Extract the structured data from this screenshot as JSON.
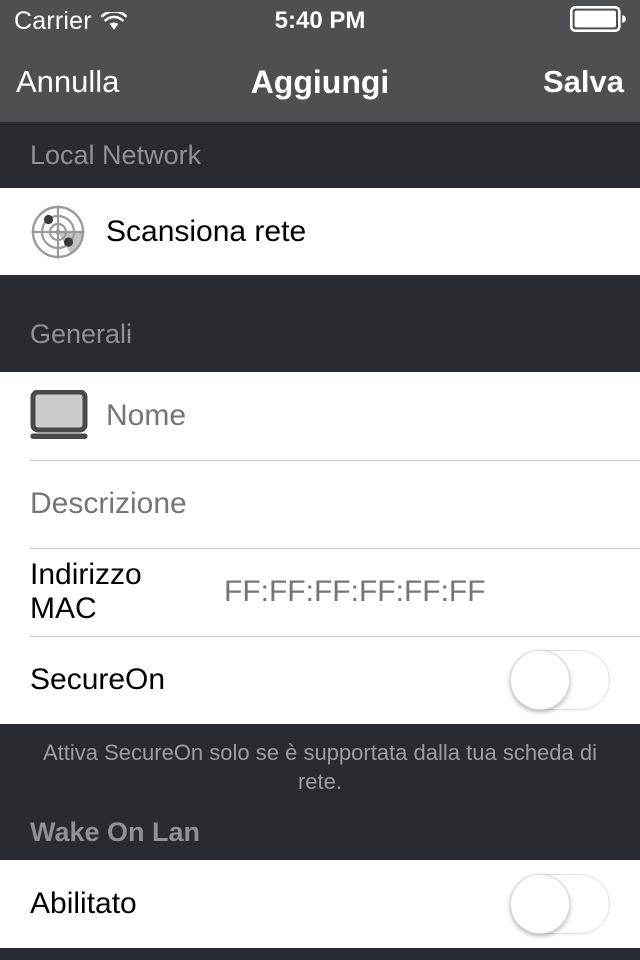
{
  "status_bar": {
    "carrier": "Carrier",
    "wifi_icon": "wifi-icon",
    "time": "5:40 PM",
    "battery_icon": "battery-full-icon"
  },
  "nav_bar": {
    "cancel_label": "Annulla",
    "title": "Aggiungi",
    "save_label": "Salva"
  },
  "sections": {
    "local_network": {
      "header": "Local Network",
      "scan_row": {
        "icon": "radar-icon",
        "label": "Scansiona rete"
      }
    },
    "general": {
      "header": "Generali",
      "name_row": {
        "icon": "laptop-icon",
        "placeholder": "Nome",
        "value": ""
      },
      "description_row": {
        "placeholder": "Descrizione",
        "value": ""
      },
      "mac_row": {
        "label": "Indirizzo MAC",
        "placeholder": "FF:FF:FF:FF:FF:FF",
        "value": ""
      },
      "secureon_row": {
        "label": "SecureOn",
        "toggle_state": "off"
      },
      "footer": "Attiva SecureOn solo se è supportata dalla tua scheda di rete."
    },
    "wake_on_lan": {
      "header": "Wake On Lan",
      "enabled_row": {
        "label": "Abilitato",
        "toggle_state": "off"
      }
    }
  },
  "colors": {
    "nav_bar_bg": "#4c5053",
    "section_bg": "#282c30",
    "row_bg": "#ffffff",
    "header_text": "#8e9296",
    "placeholder_text": "#bdbdbd",
    "separator": "#c9c9c9"
  }
}
